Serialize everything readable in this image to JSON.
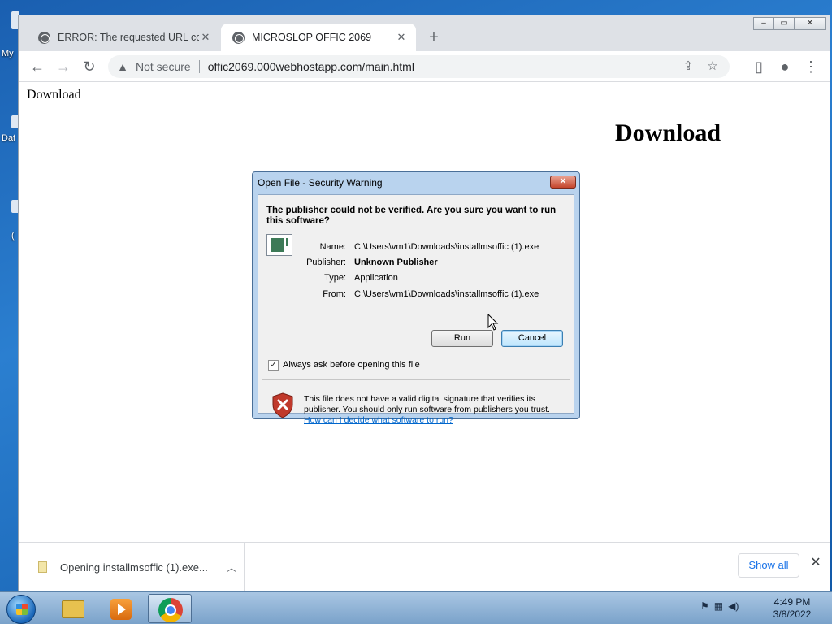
{
  "desktop": {
    "labels": [
      "My",
      "Dat",
      "("
    ]
  },
  "browser": {
    "tabs": [
      {
        "title": "ERROR: The requested URL could",
        "close": "✕"
      },
      {
        "title": "MICROSLOP OFFIC 2069",
        "close": "✕"
      }
    ],
    "new_tab": "+",
    "window_controls": [
      "–",
      "▭",
      "✕"
    ],
    "security_label": "Not secure",
    "url": "offic2069.000webhostapp.com/main.html"
  },
  "page": {
    "link_text": "Download",
    "heading": "Download"
  },
  "download_bar": {
    "item_text": "Opening installmsoffic (1).exe...",
    "show_all": "Show all",
    "close": "✕"
  },
  "dialog": {
    "title": "Open File - Security Warning",
    "close": "✕",
    "question": "The publisher could not be verified.  Are you sure you want to run this software?",
    "fields": [
      {
        "label": "Name:",
        "value": "C:\\Users\\vm1\\Downloads\\installmsoffic (1).exe"
      },
      {
        "label": "Publisher:",
        "value": "Unknown Publisher"
      },
      {
        "label": "Type:",
        "value": "Application"
      },
      {
        "label": "From:",
        "value": "C:\\Users\\vm1\\Downloads\\installmsoffic (1).exe"
      }
    ],
    "run_label": "Run",
    "cancel_label": "Cancel",
    "checkbox_label": "Always ask before opening this file",
    "checkbox_checked": "✓",
    "warning_text": "This file does not have a valid digital signature that verifies its publisher.  You should only run software from publishers you trust.",
    "help_link": "How can I decide what software to run?"
  },
  "taskbar": {
    "time": "4:49 PM",
    "date": "3/8/2022"
  }
}
